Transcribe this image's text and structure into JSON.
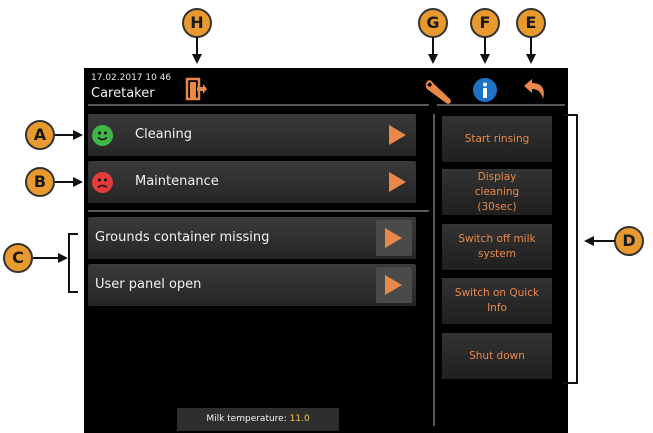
{
  "header": {
    "datetime": "17.02.2017 10 46",
    "title": "Caretaker"
  },
  "menu_items": [
    {
      "label": "Cleaning",
      "status": "happy",
      "color": "#3fb54a"
    },
    {
      "label": "Maintenance",
      "status": "sad",
      "color": "#e23b3b"
    }
  ],
  "messages": [
    {
      "label": "Grounds container missing"
    },
    {
      "label": "User panel open"
    }
  ],
  "actions": [
    {
      "label": "Start rinsing"
    },
    {
      "label": "Display cleaning (30sec)"
    },
    {
      "label": "Switch off milk system"
    },
    {
      "label": "Switch on Quick Info"
    },
    {
      "label": "Shut down"
    }
  ],
  "status": {
    "milk_label": "Milk temperature:",
    "milk_value": "11.0"
  },
  "toolbar": {
    "exit_icon": "door-exit-icon",
    "settings_icon": "wrench-icon",
    "info_icon": "info-icon",
    "back_icon": "back-arrow-icon"
  },
  "callouts": [
    "A",
    "B",
    "C",
    "D",
    "E",
    "F",
    "G",
    "H"
  ],
  "colors": {
    "accent": "#e8894a",
    "callout": "#e89a2e",
    "info_blue": "#1e73c8"
  }
}
